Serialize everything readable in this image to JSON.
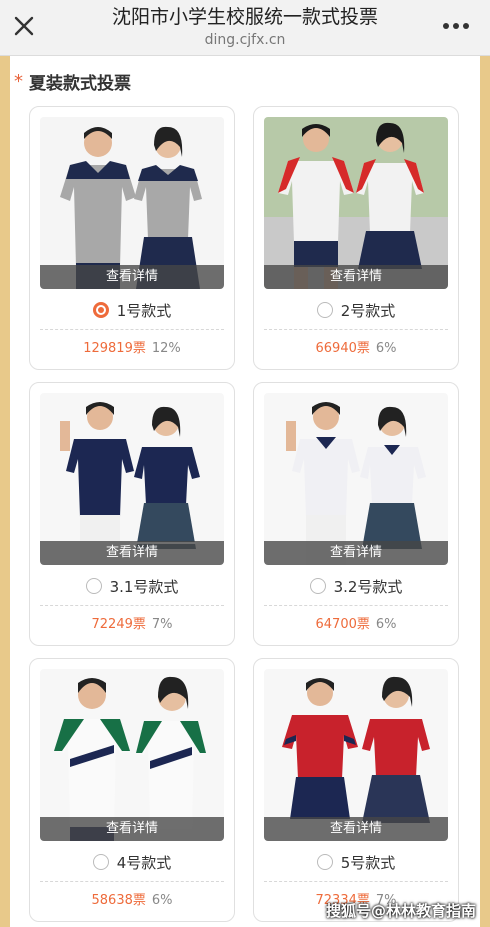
{
  "header": {
    "title": "沈阳市小学生校服统一款式投票",
    "url": "ding.cjfx.cn",
    "close_icon": "close-icon",
    "more_icon": "more-icon"
  },
  "section": {
    "asterisk": "*",
    "title": "夏装款式投票"
  },
  "cards": [
    {
      "label": "1号款式",
      "votes": "129819票",
      "pct": "12%",
      "details": "查看详情",
      "selected": true
    },
    {
      "label": "2号款式",
      "votes": "66940票",
      "pct": "6%",
      "details": "查看详情",
      "selected": false
    },
    {
      "label": "3.1号款式",
      "votes": "72249票",
      "pct": "7%",
      "details": "查看详情",
      "selected": false
    },
    {
      "label": "3.2号款式",
      "votes": "64700票",
      "pct": "6%",
      "details": "查看详情",
      "selected": false
    },
    {
      "label": "4号款式",
      "votes": "58638票",
      "pct": "6%",
      "details": "查看详情",
      "selected": false
    },
    {
      "label": "5号款式",
      "votes": "72334票",
      "pct": "7%",
      "details": "查看详情",
      "selected": false
    }
  ],
  "watermark": "搜狐号@林林教育指南",
  "colors": {
    "accent": "#ee6b3b",
    "page_border": "#e8c98a"
  }
}
